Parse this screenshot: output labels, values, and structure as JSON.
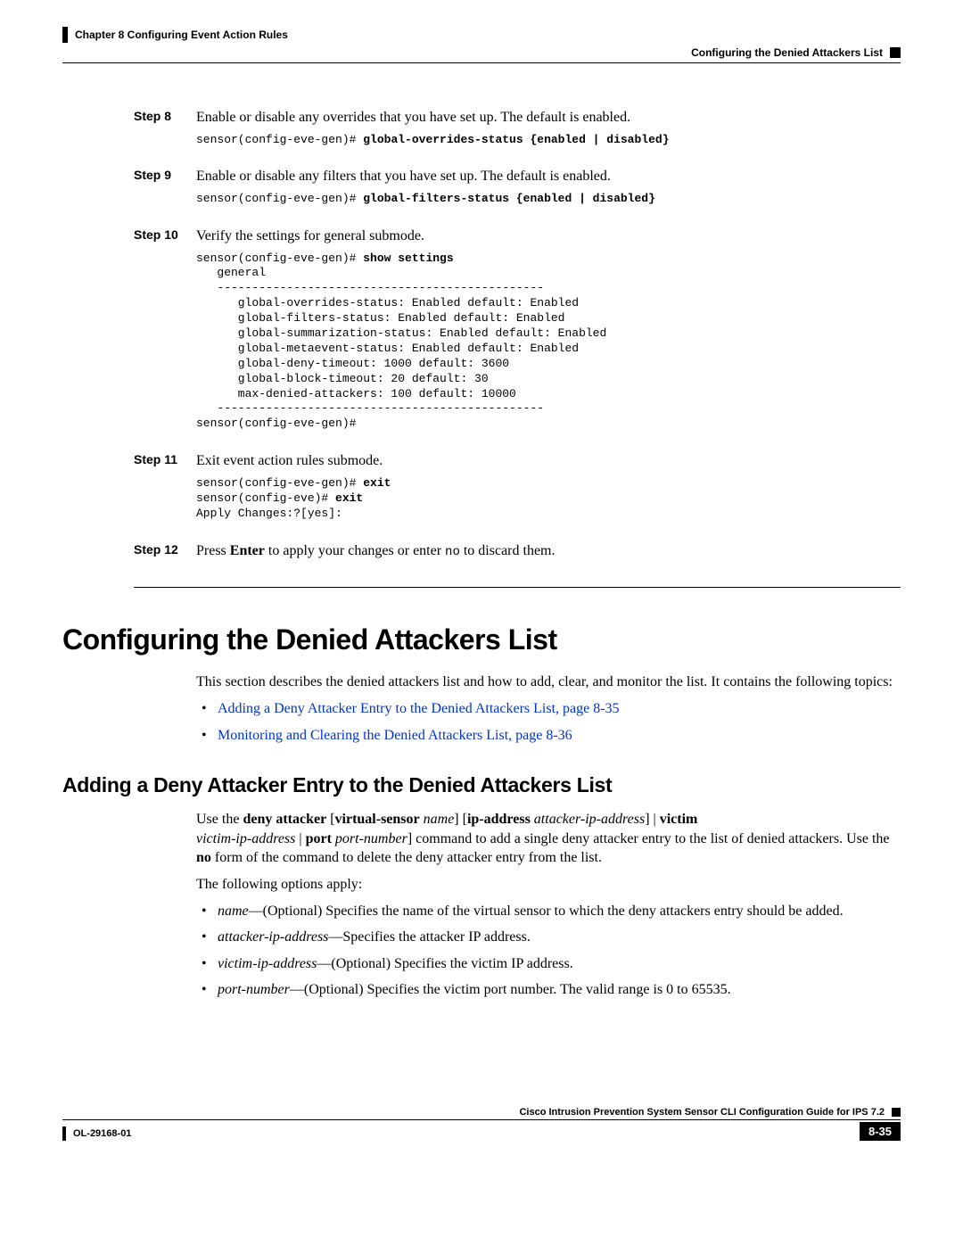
{
  "header": {
    "chapter": "Chapter 8      Configuring Event Action Rules",
    "section": "Configuring the Denied Attackers List"
  },
  "steps": {
    "s8": {
      "label": "Step 8",
      "text": "Enable or disable any overrides that you have set up. The default is enabled.",
      "code_prefix": "sensor(config-eve-gen)# ",
      "code_bold": "global-overrides-status {enabled | disabled}"
    },
    "s9": {
      "label": "Step 9",
      "text": "Enable or disable any filters that you have set up. The default is enabled.",
      "code_prefix": "sensor(config-eve-gen)# ",
      "code_bold": "global-filters-status {enabled | disabled}"
    },
    "s10": {
      "label": "Step 10",
      "text": "Verify the settings for general submode.",
      "code_prefix": "sensor(config-eve-gen)# ",
      "code_bold": "show settings",
      "code_block": "   general\n   -----------------------------------------------\n      global-overrides-status: Enabled default: Enabled\n      global-filters-status: Enabled default: Enabled\n      global-summarization-status: Enabled default: Enabled\n      global-metaevent-status: Enabled default: Enabled\n      global-deny-timeout: 1000 default: 3600\n      global-block-timeout: 20 default: 30\n      max-denied-attackers: 100 default: 10000\n   -----------------------------------------------\nsensor(config-eve-gen)#"
    },
    "s11": {
      "label": "Step 11",
      "text": "Exit event action rules submode.",
      "code_l1p": "sensor(config-eve-gen)# ",
      "code_l1b": "exit",
      "code_l2p": "sensor(config-eve)# ",
      "code_l2b": "exit",
      "code_l3": "Apply Changes:?[yes]:"
    },
    "s12": {
      "label": "Step 12",
      "text_a": "Press ",
      "text_b": "Enter",
      "text_c": " to apply your changes or enter ",
      "text_d": "no",
      "text_e": "  to discard them."
    }
  },
  "section_title": "Configuring the Denied Attackers List",
  "intro": "This section describes the denied attackers list and how to add, clear, and monitor the list. It contains the following topics:",
  "links": {
    "l1": "Adding a Deny Attacker Entry to the Denied Attackers List, page 8-35",
    "l2": "Monitoring and Clearing the Denied Attackers List, page 8-36"
  },
  "subsection_title": "Adding a Deny Attacker Entry to the Denied Attackers List",
  "usage": {
    "p1a": "Use the ",
    "p1b": "deny attacker",
    "p1c": " [",
    "p1d": "virtual-sensor",
    "p1e": " ",
    "p1f": "name",
    "p1g": "] [",
    "p1h": "ip-address",
    "p1i": " ",
    "p1j": "attacker-ip-address",
    "p1k": "] | ",
    "p1l": "victim",
    "p2a": "victim-ip-address",
    "p2b": " | ",
    "p2c": "port",
    "p2d": " ",
    "p2e": "port-number",
    "p2f": "] command to add a single deny attacker entry to the list of denied attackers. Use the ",
    "p2g": "no",
    "p2h": " form of the command to delete the deny attacker entry from the list."
  },
  "options_intro": "The following options apply:",
  "opts": {
    "o1a": "name",
    "o1b": "—(Optional) Specifies the name of the virtual sensor to which the deny attackers entry should be added.",
    "o2a": "attacker-ip-address",
    "o2b": "—Specifies the attacker IP address.",
    "o3a": "victim-ip-address",
    "o3b": "—(Optional) Specifies the victim IP address.",
    "o4a": "port-number",
    "o4b": "—(Optional) Specifies the victim port number. The valid range is 0 to 65535."
  },
  "footer": {
    "guide": "Cisco Intrusion Prevention System Sensor CLI Configuration Guide for IPS 7.2",
    "doc": "OL-29168-01",
    "page": "8-35"
  }
}
